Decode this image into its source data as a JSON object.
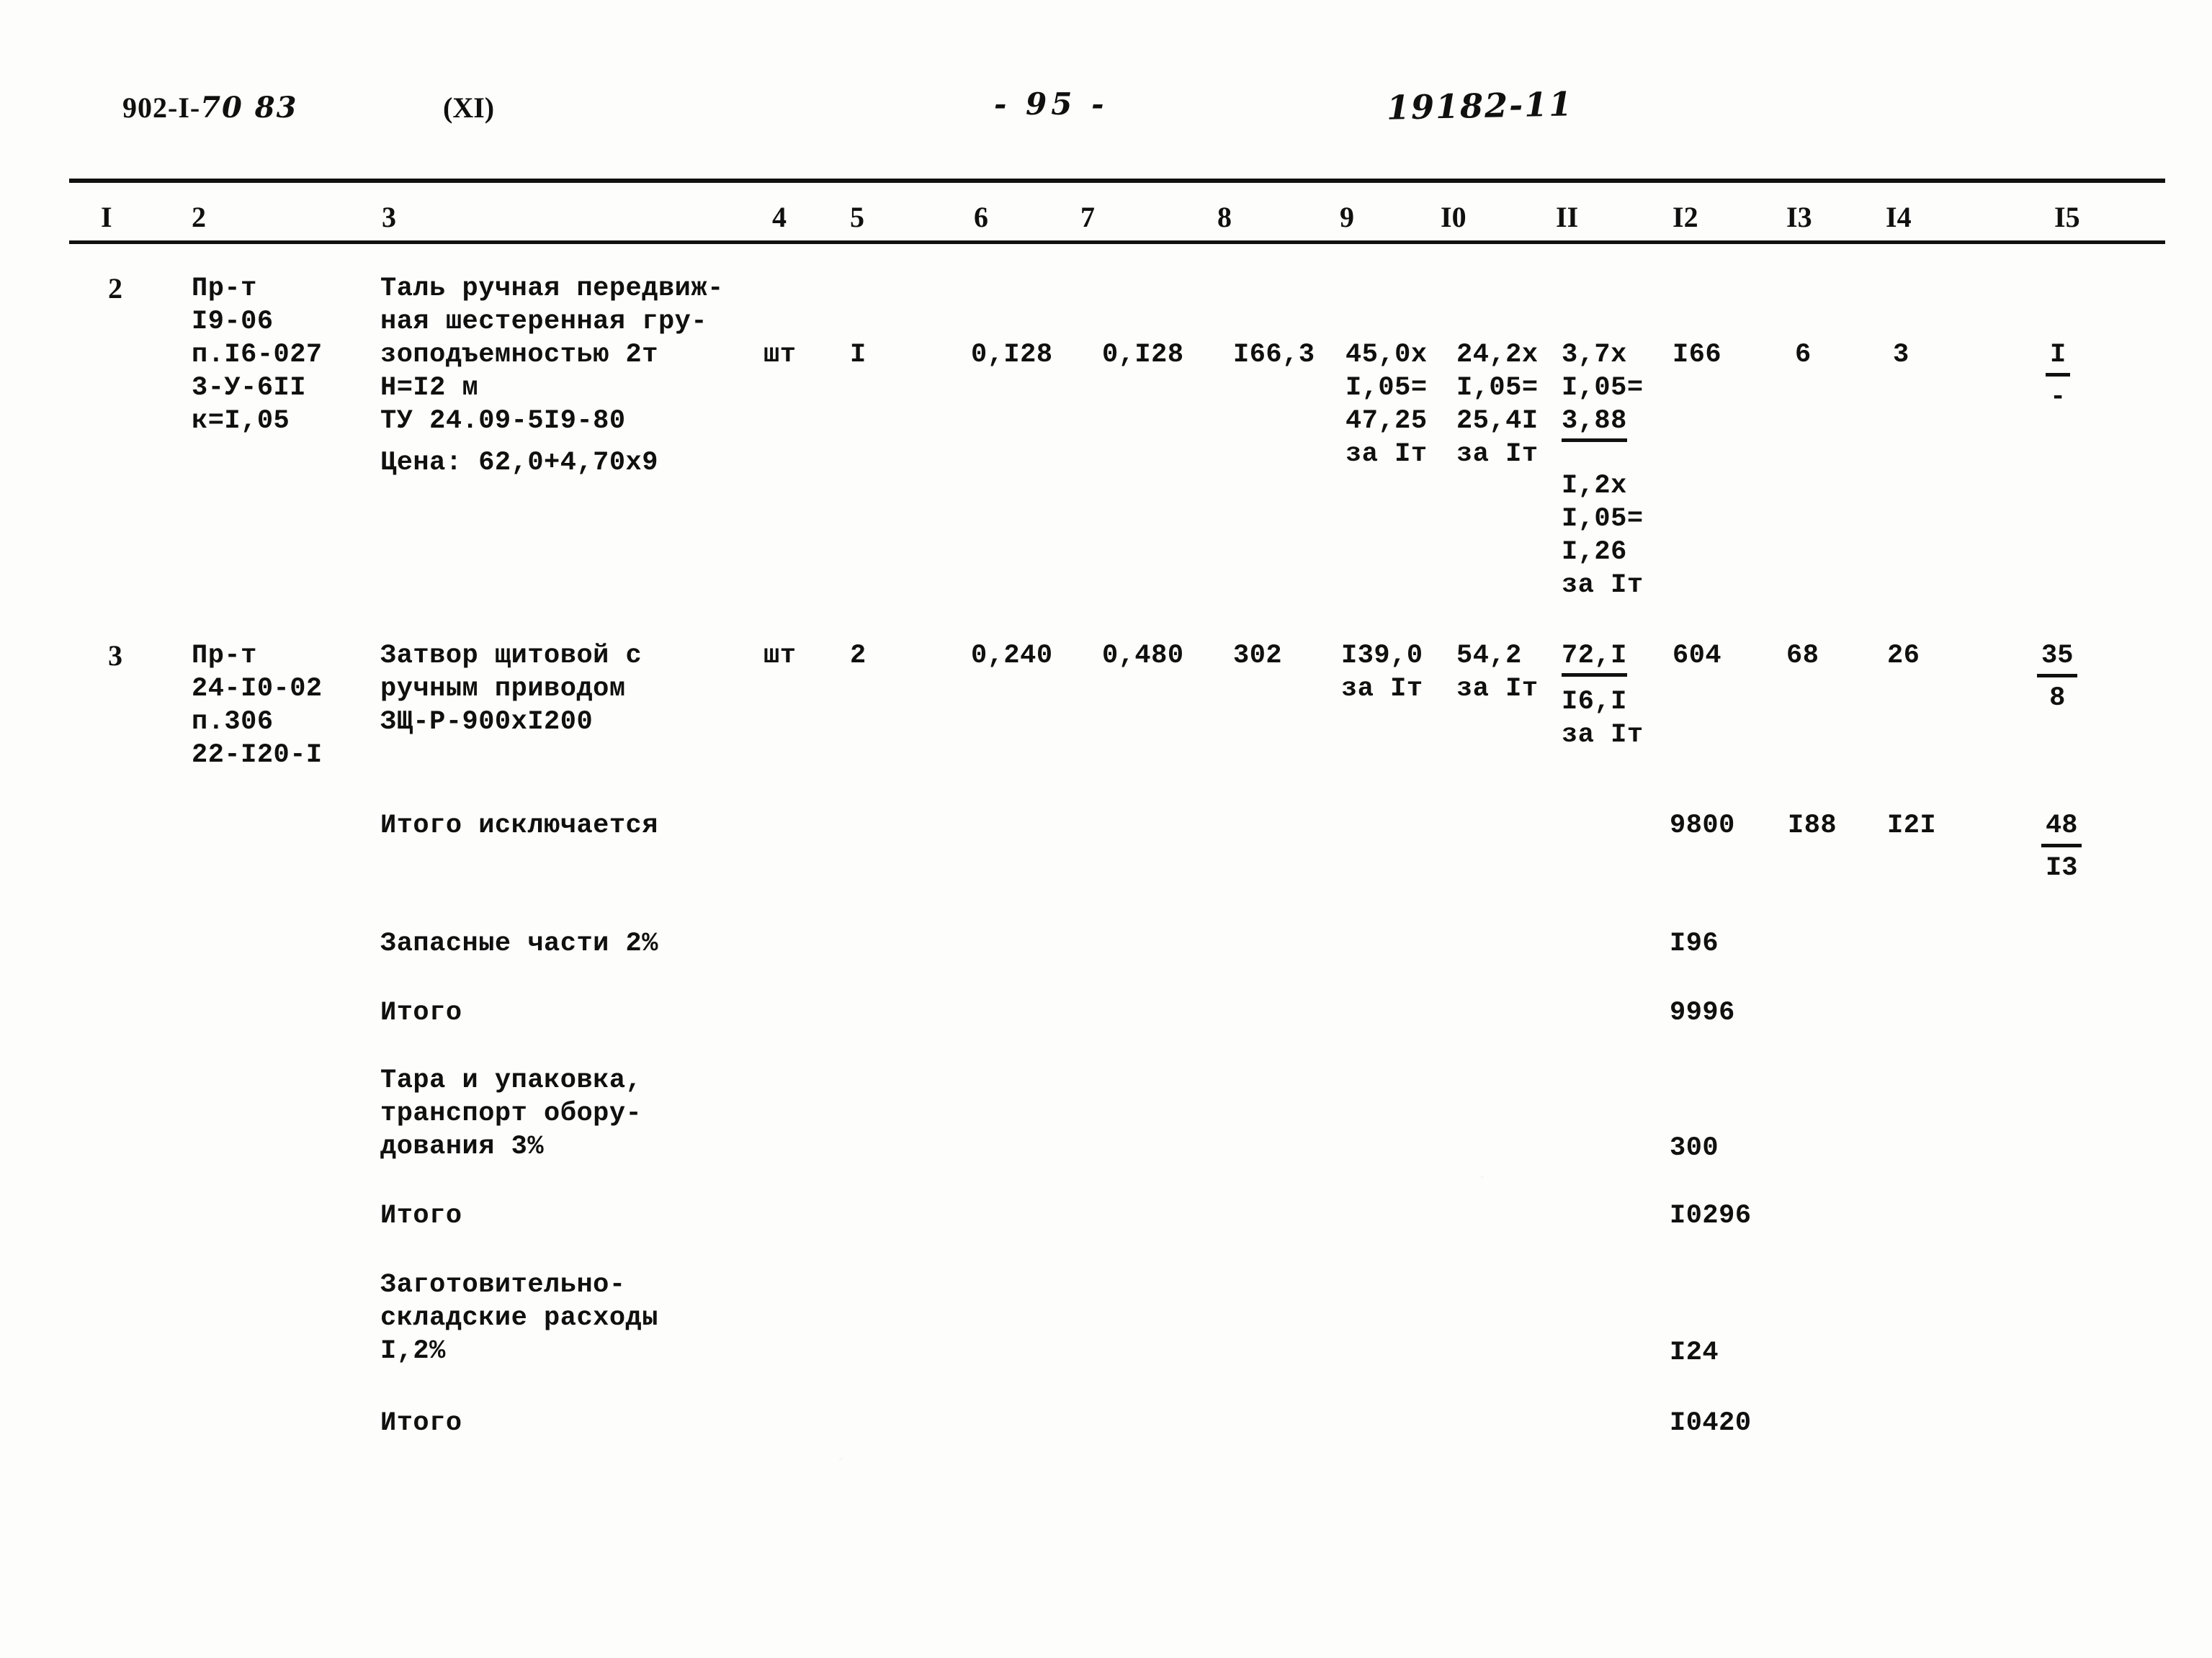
{
  "header": {
    "doc_code_printed": "902-I-",
    "doc_code_hand": "70 83",
    "album": "(XI)",
    "page_number": "- 95 -",
    "sheet_ref": "19182-11"
  },
  "table": {
    "column_numbers": [
      "I",
      "2",
      "3",
      "4",
      "5",
      "6",
      "7",
      "8",
      "9",
      "I0",
      "II",
      "I2",
      "I3",
      "I4",
      "I5"
    ],
    "rows": [
      {
        "row_number": "2",
        "code": "Пр-т\nI9-06\nп.I6-027\n3-У-6II\nк=I,05",
        "description": "Таль ручная передвиж-\nная шестеренная гру-\nзоподъемностью 2т\nН=I2 м\nТУ 24.09-5I9-80",
        "price_note": "Цена: 62,0+4,70х9",
        "unit": "шт",
        "qty": "I",
        "col6": "0,I28",
        "col7": "0,I28",
        "col8": "I66,3",
        "col9": "45,0х\nI,05=\n47,25\nза Iт",
        "col10": "24,2х\nI,05=\n25,4I\nза Iт",
        "col11_a": "3,7х\nI,05=",
        "col11_underlined": "3,88",
        "col11_b": "I,2х\nI,05=\nI,26\nза Iт",
        "col12": "I66",
        "col13": "6",
        "col14": "3",
        "col15_num": "I",
        "col15_den": "-"
      },
      {
        "row_number": "3",
        "code": "Пр-т\n24-I0-02\nп.306\n22-I20-I",
        "description": "Затвор щитовой с\nручным приводом\nЗЩ-Р-900хI200",
        "unit": "шт",
        "qty": "2",
        "col6": "0,240",
        "col7": "0,480",
        "col8": "302",
        "col9": "I39,0\nза Iт",
        "col10": "54,2\nза Iт",
        "col11_underlined": "72,I",
        "col11_b": "I6,I\nза Iт",
        "col12": "604",
        "col13": "68",
        "col14": "26",
        "col15_num": "35",
        "col15_den": "8"
      }
    ],
    "summary": [
      {
        "label": "Итого исключается",
        "col12": "9800",
        "col13": "I88",
        "col14": "I2I",
        "col15_num": "48",
        "col15_den": "I3"
      },
      {
        "label": "Запасные части 2%",
        "col12": "I96"
      },
      {
        "label": "Итого",
        "col12": "9996"
      },
      {
        "label": "Тара и упаковка,\nтранспорт обору-\nдования 3%",
        "col12": "300"
      },
      {
        "label": "Итого",
        "col12": "I0296"
      },
      {
        "label": "Заготовительно-\nскладские расходы\nI,2%",
        "col12": "I24"
      },
      {
        "label": "Итого",
        "col12": "I0420"
      }
    ]
  }
}
